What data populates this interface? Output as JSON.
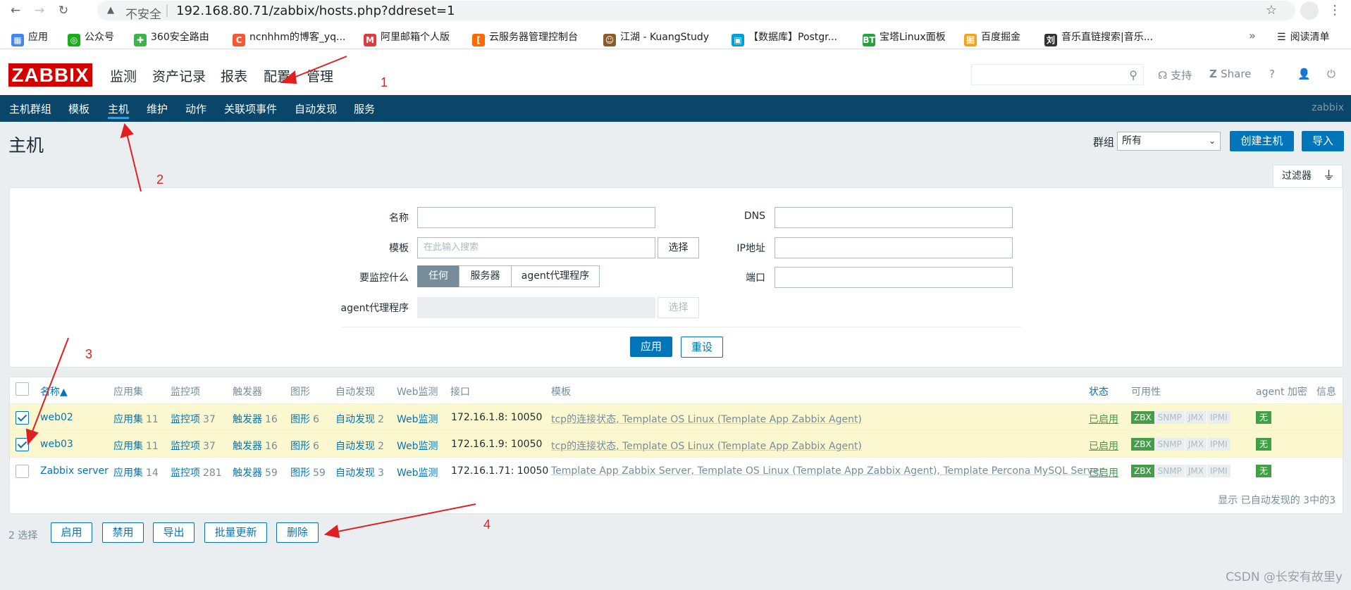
{
  "browser": {
    "insecure_label": "不安全",
    "url": "192.168.80.71/zabbix/hosts.php?ddreset=1",
    "bookmarks": [
      {
        "label": "应用",
        "color": "#4285f4"
      },
      {
        "label": "公众号",
        "color": "#1aad19"
      },
      {
        "label": "360安全路由",
        "color": "#3db34a"
      },
      {
        "label": "ncnhhm的博客_yq...",
        "color": "#fc5531"
      },
      {
        "label": "阿里邮箱个人版",
        "color": "#e4393c"
      },
      {
        "label": "云服务器管理控制台",
        "color": "#ff6a00"
      },
      {
        "label": "江湖 - KuangStudy",
        "color": "#8b5a2b"
      },
      {
        "label": "【数据库】Postgr...",
        "color": "#00a1d6"
      },
      {
        "label": "宝塔Linux面板",
        "color": "#20a53a"
      },
      {
        "label": "百度掘金",
        "color": "#f4a020"
      },
      {
        "label": "音乐直链搜索|音乐...",
        "color": "#333333"
      }
    ],
    "bookmark_more": "»",
    "reading_list": "阅读清单"
  },
  "header": {
    "logo": "ZABBIX",
    "menu": [
      "监测",
      "资产记录",
      "报表",
      "配置",
      "管理"
    ],
    "support": "支持",
    "share": "Share",
    "help": "?"
  },
  "submenu": {
    "items": [
      "主机群组",
      "模板",
      "主机",
      "维护",
      "动作",
      "关联项事件",
      "自动发现",
      "服务"
    ],
    "active": "主机",
    "right_label": "zabbix"
  },
  "page": {
    "title": "主机",
    "group_label": "群组",
    "group_value": "所有",
    "create_host": "创建主机",
    "import": "导入"
  },
  "filter": {
    "tab_label": "过滤器",
    "name_label": "名称",
    "template_label": "模板",
    "template_placeholder": "在此输入搜索",
    "select_label": "选择",
    "monitor_label": "要监控什么",
    "monitor_options": [
      "任何",
      "服务器",
      "agent代理程序"
    ],
    "monitor_active": "任何",
    "agent_proxy_label": "agent代理程序",
    "dns_label": "DNS",
    "ip_label": "IP地址",
    "port_label": "端口",
    "apply": "应用",
    "reset": "重设"
  },
  "table": {
    "headers": [
      "名称▲",
      "应用集",
      "监控项",
      "触发器",
      "图形",
      "自动发现",
      "Web监测",
      "接口",
      "模板",
      "状态",
      "可用性",
      "agent 加密",
      "信息"
    ],
    "rows": [
      {
        "selected": true,
        "name": "web02",
        "apps_label": "应用集",
        "apps": "11",
        "items_label": "监控项",
        "items": "37",
        "triggers_label": "触发器",
        "triggers": "16",
        "graphs_label": "图形",
        "graphs": "6",
        "discovery_label": "自动发现",
        "discovery": "2",
        "web": "Web监测",
        "interface": "172.16.1.8: 10050",
        "templates": "tcp的连接状态, Template OS Linux (Template App Zabbix Agent)",
        "status": "已启用",
        "encryption": "无"
      },
      {
        "selected": true,
        "name": "web03",
        "apps_label": "应用集",
        "apps": "11",
        "items_label": "监控项",
        "items": "37",
        "triggers_label": "触发器",
        "triggers": "16",
        "graphs_label": "图形",
        "graphs": "6",
        "discovery_label": "自动发现",
        "discovery": "2",
        "web": "Web监测",
        "interface": "172.16.1.9: 10050",
        "templates": "tcp的连接状态, Template OS Linux (Template App Zabbix Agent)",
        "status": "已启用",
        "encryption": "无"
      },
      {
        "selected": false,
        "name": "Zabbix server",
        "apps_label": "应用集",
        "apps": "14",
        "items_label": "监控项",
        "items": "281",
        "triggers_label": "触发器",
        "triggers": "59",
        "graphs_label": "图形",
        "graphs": "59",
        "discovery_label": "自动发现",
        "discovery": "3",
        "web": "Web监测",
        "interface": "172.16.1.71: 10050",
        "templates": "Template App Zabbix Server, Template OS Linux (Template App Zabbix Agent), Template Percona MySQL Server",
        "status": "已启用",
        "encryption": "无"
      }
    ],
    "availability": [
      "ZBX",
      "SNMP",
      "JMX",
      "IPMI"
    ],
    "footer": "显示 已自动发现的 3中的3"
  },
  "actions": {
    "selected_count": "2 选择",
    "buttons": [
      "启用",
      "禁用",
      "导出",
      "批量更新",
      "删除"
    ]
  },
  "annotations": {
    "numbers": [
      "1",
      "2",
      "3",
      "4"
    ],
    "color": "#e02020"
  },
  "watermark": "CSDN @长安有故里y",
  "colors": {
    "brand_red": "#d40000",
    "nav_blue": "#0a466a",
    "link_blue": "#0275b8",
    "enabled_green": "#429e47",
    "selected_row": "#fbf7cf"
  }
}
